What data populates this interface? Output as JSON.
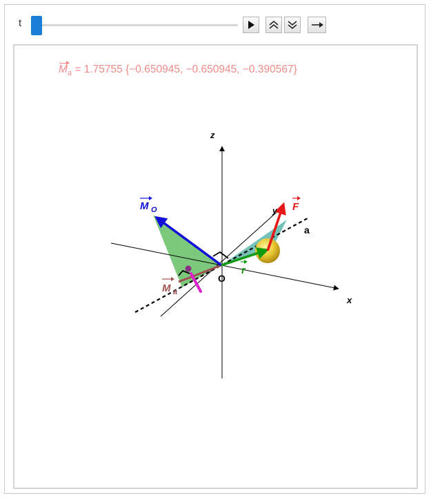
{
  "controls": {
    "param_label": "t",
    "slider_value_fraction": 0.0,
    "buttons": [
      {
        "name": "play-button",
        "icon": "play-icon"
      },
      {
        "name": "faster-button",
        "icon": "double-chevron-up-icon"
      },
      {
        "name": "slower-button",
        "icon": "double-chevron-down-icon"
      },
      {
        "name": "direction-button",
        "icon": "right-arrow-icon"
      }
    ]
  },
  "formula": {
    "symbol": "M",
    "subscript": "a",
    "equals": "=",
    "magnitude": "1.75755",
    "vector": "{−0.650945, −0.650945, −0.390567}"
  },
  "scene_labels": {
    "z_axis": "z",
    "x_axis": "x",
    "y_axis": "y",
    "origin": "O",
    "axis_a": "a",
    "moment_o": "M",
    "moment_o_sub": "O",
    "force": "F",
    "position": "r",
    "moment_a": "M",
    "moment_a_sub": "a"
  },
  "colors": {
    "slider_accent": "#1a7fd6",
    "formula": "#f08a8a",
    "moment_o": "#1010d8",
    "force": "#e51717",
    "position": "#109a10",
    "moment_a": "#a05050",
    "moment_a_handle": "#e020d0",
    "plane_green": "#45b045",
    "plane_teal": "#2aa090",
    "sphere": "#e8c832"
  }
}
